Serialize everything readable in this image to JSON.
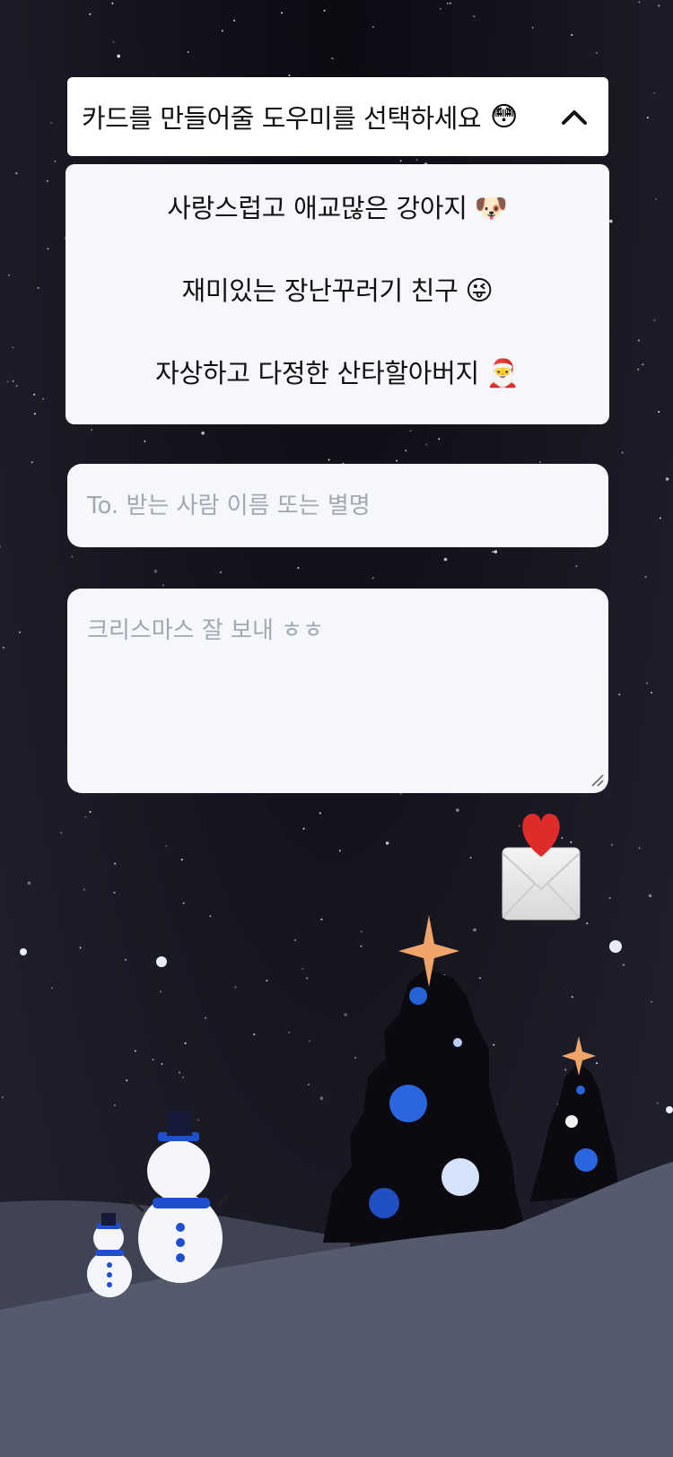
{
  "dropdown": {
    "title": "카드를 만들어줄 도우미를 선택하세요",
    "title_emoji": "😳",
    "chevron_icon": "chevron-up-icon",
    "options": [
      {
        "label": "사랑스럽고 애교많은 강아지",
        "emoji": "🐶"
      },
      {
        "label": "재미있는 장난꾸러기 친구",
        "emoji": "😜"
      },
      {
        "label": "자상하고 다정한 산타할아버지",
        "emoji": "🎅"
      }
    ]
  },
  "recipient": {
    "placeholder": "To. 받는 사람 이름 또는 별명",
    "value": ""
  },
  "message": {
    "placeholder": "크리스마스 잘 보내 ㅎㅎ",
    "value": ""
  },
  "send_button": {
    "icon": "love-letter-icon"
  },
  "colors": {
    "background": "#1a1a24",
    "card_bg": "#f6f7fa",
    "placeholder": "#a3a7b2",
    "tree_ornament": "#2563d6",
    "star": "#f0a46a",
    "snowman_hat": "#1f4fd1",
    "ground": "#5a5f72"
  }
}
